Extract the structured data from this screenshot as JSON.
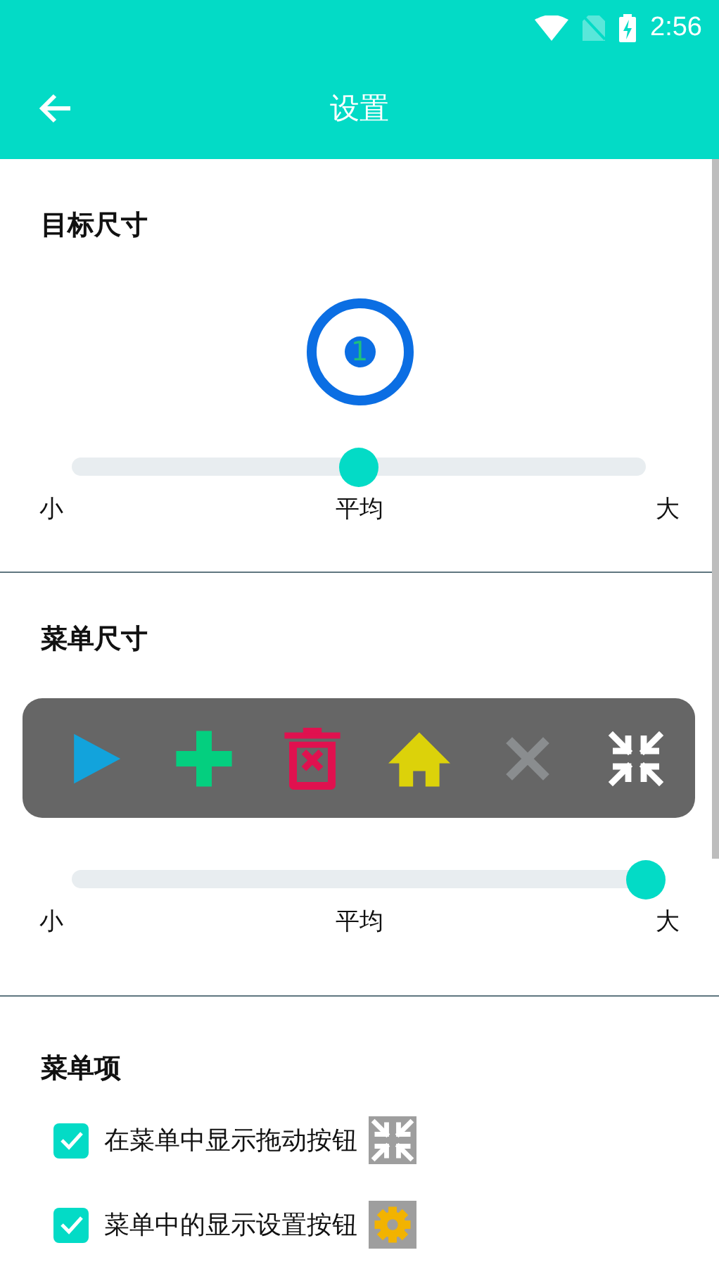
{
  "status_bar": {
    "time": "2:56"
  },
  "toolbar": {
    "title": "设置"
  },
  "target_size": {
    "title": "目标尺寸",
    "preview_number": "1",
    "slider": {
      "level": 0.5,
      "labels": [
        "小",
        "平均",
        "大"
      ]
    }
  },
  "menu_size": {
    "title": "菜单尺寸",
    "menu_icons": [
      {
        "kind": "play"
      },
      {
        "kind": "add"
      },
      {
        "kind": "delete"
      },
      {
        "kind": "home"
      },
      {
        "kind": "close"
      },
      {
        "kind": "collapse"
      }
    ],
    "slider": {
      "level": 1,
      "labels": [
        "小",
        "平均",
        "大"
      ]
    }
  },
  "menu_items": {
    "title": "菜单项",
    "items": [
      {
        "label": "在菜单中显示拖动按钮",
        "checked": true,
        "kind": "collapse"
      },
      {
        "label": "菜单中的显示设置按钮",
        "checked": true,
        "kind": "settings"
      }
    ]
  }
}
